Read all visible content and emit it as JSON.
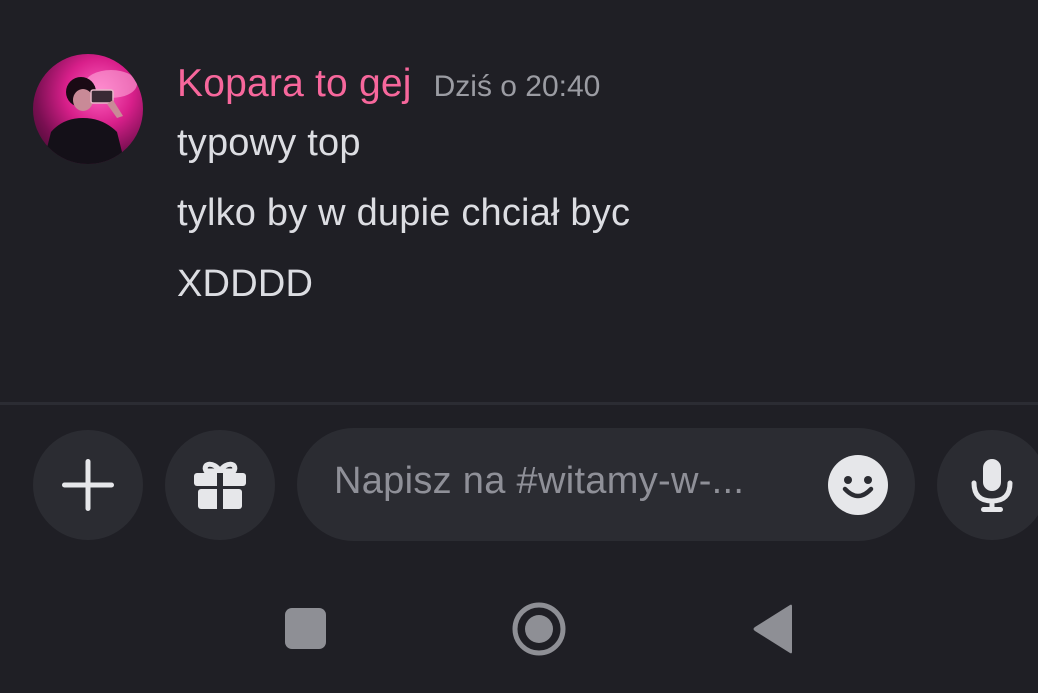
{
  "message": {
    "author": "Kopara to gej",
    "timestamp": "Dziś o 20:40",
    "lines": [
      "typowy top",
      "tylko by w dupie chciał byc",
      "XDDDD"
    ],
    "author_color": "#f7679c"
  },
  "composer": {
    "placeholder": "Napisz na #witamy-w-...",
    "icons": {
      "attach": "plus-icon",
      "gift": "gift-icon",
      "emoji": "emoji-icon",
      "voice": "microphone-icon"
    }
  },
  "nav": {
    "icons": [
      "recent-apps-icon",
      "home-icon",
      "back-icon"
    ]
  },
  "colors": {
    "background": "#1f1f25",
    "button_bg": "#2b2c32",
    "text": "#dcdde2",
    "muted": "#9b9ca3"
  }
}
